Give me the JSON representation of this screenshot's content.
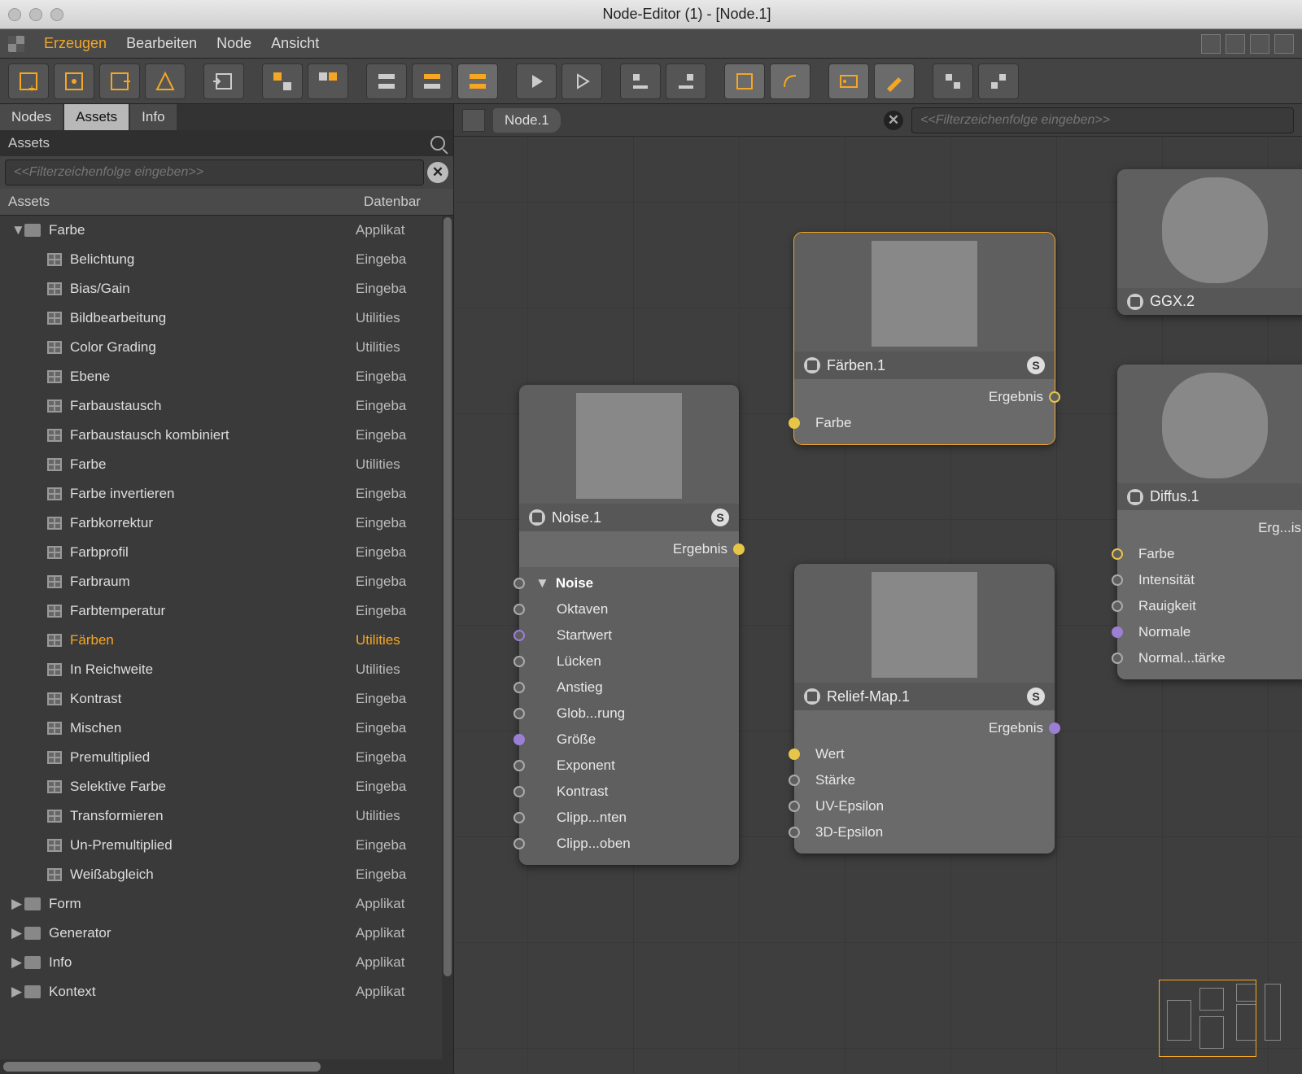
{
  "window": {
    "title": "Node-Editor (1) - [Node.1]"
  },
  "menu": {
    "items": [
      "Erzeugen",
      "Bearbeiten",
      "Node",
      "Ansicht"
    ],
    "active_index": 0
  },
  "sidebar": {
    "tabs": [
      "Nodes",
      "Assets",
      "Info"
    ],
    "active_tab": 1,
    "panel_title": "Assets",
    "filter_placeholder": "<<Filterzeichenfolge eingeben>>",
    "columns": [
      "Assets",
      "Datenbar"
    ],
    "tree": [
      {
        "type": "folder",
        "label": "Farbe",
        "db": "Applikat",
        "depth": 0,
        "expanded": true
      },
      {
        "type": "node",
        "label": "Belichtung",
        "db": "Eingeba",
        "depth": 1
      },
      {
        "type": "node",
        "label": "Bias/Gain",
        "db": "Eingeba",
        "depth": 1
      },
      {
        "type": "node",
        "label": "Bildbearbeitung",
        "db": "Utilities",
        "depth": 1
      },
      {
        "type": "node",
        "label": "Color Grading",
        "db": "Utilities",
        "depth": 1
      },
      {
        "type": "node",
        "label": "Ebene",
        "db": "Eingeba",
        "depth": 1
      },
      {
        "type": "node",
        "label": "Farbaustausch",
        "db": "Eingeba",
        "depth": 1
      },
      {
        "type": "node",
        "label": "Farbaustausch kombiniert",
        "db": "Eingeba",
        "depth": 1
      },
      {
        "type": "node",
        "label": "Farbe",
        "db": "Utilities",
        "depth": 1
      },
      {
        "type": "node",
        "label": "Farbe invertieren",
        "db": "Eingeba",
        "depth": 1
      },
      {
        "type": "node",
        "label": "Farbkorrektur",
        "db": "Eingeba",
        "depth": 1
      },
      {
        "type": "node",
        "label": "Farbprofil",
        "db": "Eingeba",
        "depth": 1
      },
      {
        "type": "node",
        "label": "Farbraum",
        "db": "Eingeba",
        "depth": 1
      },
      {
        "type": "node",
        "label": "Farbtemperatur",
        "db": "Eingeba",
        "depth": 1
      },
      {
        "type": "node",
        "label": "Färben",
        "db": "Utilities",
        "depth": 1,
        "selected": true
      },
      {
        "type": "node",
        "label": "In Reichweite",
        "db": "Utilities",
        "depth": 1
      },
      {
        "type": "node",
        "label": "Kontrast",
        "db": "Eingeba",
        "depth": 1
      },
      {
        "type": "node",
        "label": "Mischen",
        "db": "Eingeba",
        "depth": 1
      },
      {
        "type": "node",
        "label": "Premultiplied",
        "db": "Eingeba",
        "depth": 1
      },
      {
        "type": "node",
        "label": "Selektive Farbe",
        "db": "Eingeba",
        "depth": 1
      },
      {
        "type": "node",
        "label": "Transformieren",
        "db": "Utilities",
        "depth": 1
      },
      {
        "type": "node",
        "label": "Un-Premultiplied",
        "db": "Eingeba",
        "depth": 1
      },
      {
        "type": "node",
        "label": "Weißabgleich",
        "db": "Eingeba",
        "depth": 1
      },
      {
        "type": "folder",
        "label": "Form",
        "db": "Applikat",
        "depth": 0,
        "expanded": false
      },
      {
        "type": "folder",
        "label": "Generator",
        "db": "Applikat",
        "depth": 0,
        "expanded": false
      },
      {
        "type": "folder",
        "label": "Info",
        "db": "Applikat",
        "depth": 0,
        "expanded": false
      },
      {
        "type": "folder",
        "label": "Kontext",
        "db": "Applikat",
        "depth": 0,
        "expanded": false
      }
    ]
  },
  "graph": {
    "breadcrumb": "Node.1",
    "filter_placeholder": "<<Filterzeichenfolge eingeben>>",
    "nodes": {
      "noise": {
        "title": "Noise.1",
        "out": "Ergebnis",
        "group": "Noise",
        "params": [
          "Oktaven",
          "Startwert",
          "Lücken",
          "Anstieg",
          "Glob...rung",
          "Größe",
          "Exponent",
          "Kontrast",
          "Clipp...nten",
          "Clipp...oben"
        ]
      },
      "faerben": {
        "title": "Färben.1",
        "out": "Ergebnis",
        "in": "Farbe"
      },
      "relief": {
        "title": "Relief-Map.1",
        "out": "Ergebnis",
        "ins": [
          "Wert",
          "Stärke",
          "UV-Epsilon",
          "3D-Epsilon"
        ]
      },
      "ggx": {
        "title": "GGX.2"
      },
      "diffus": {
        "title": "Diffus.1",
        "out": "Erg...is",
        "ins": [
          "Farbe",
          "Intensität",
          "Rauigkeit",
          "Normale",
          "Normal...tärke"
        ]
      }
    }
  }
}
